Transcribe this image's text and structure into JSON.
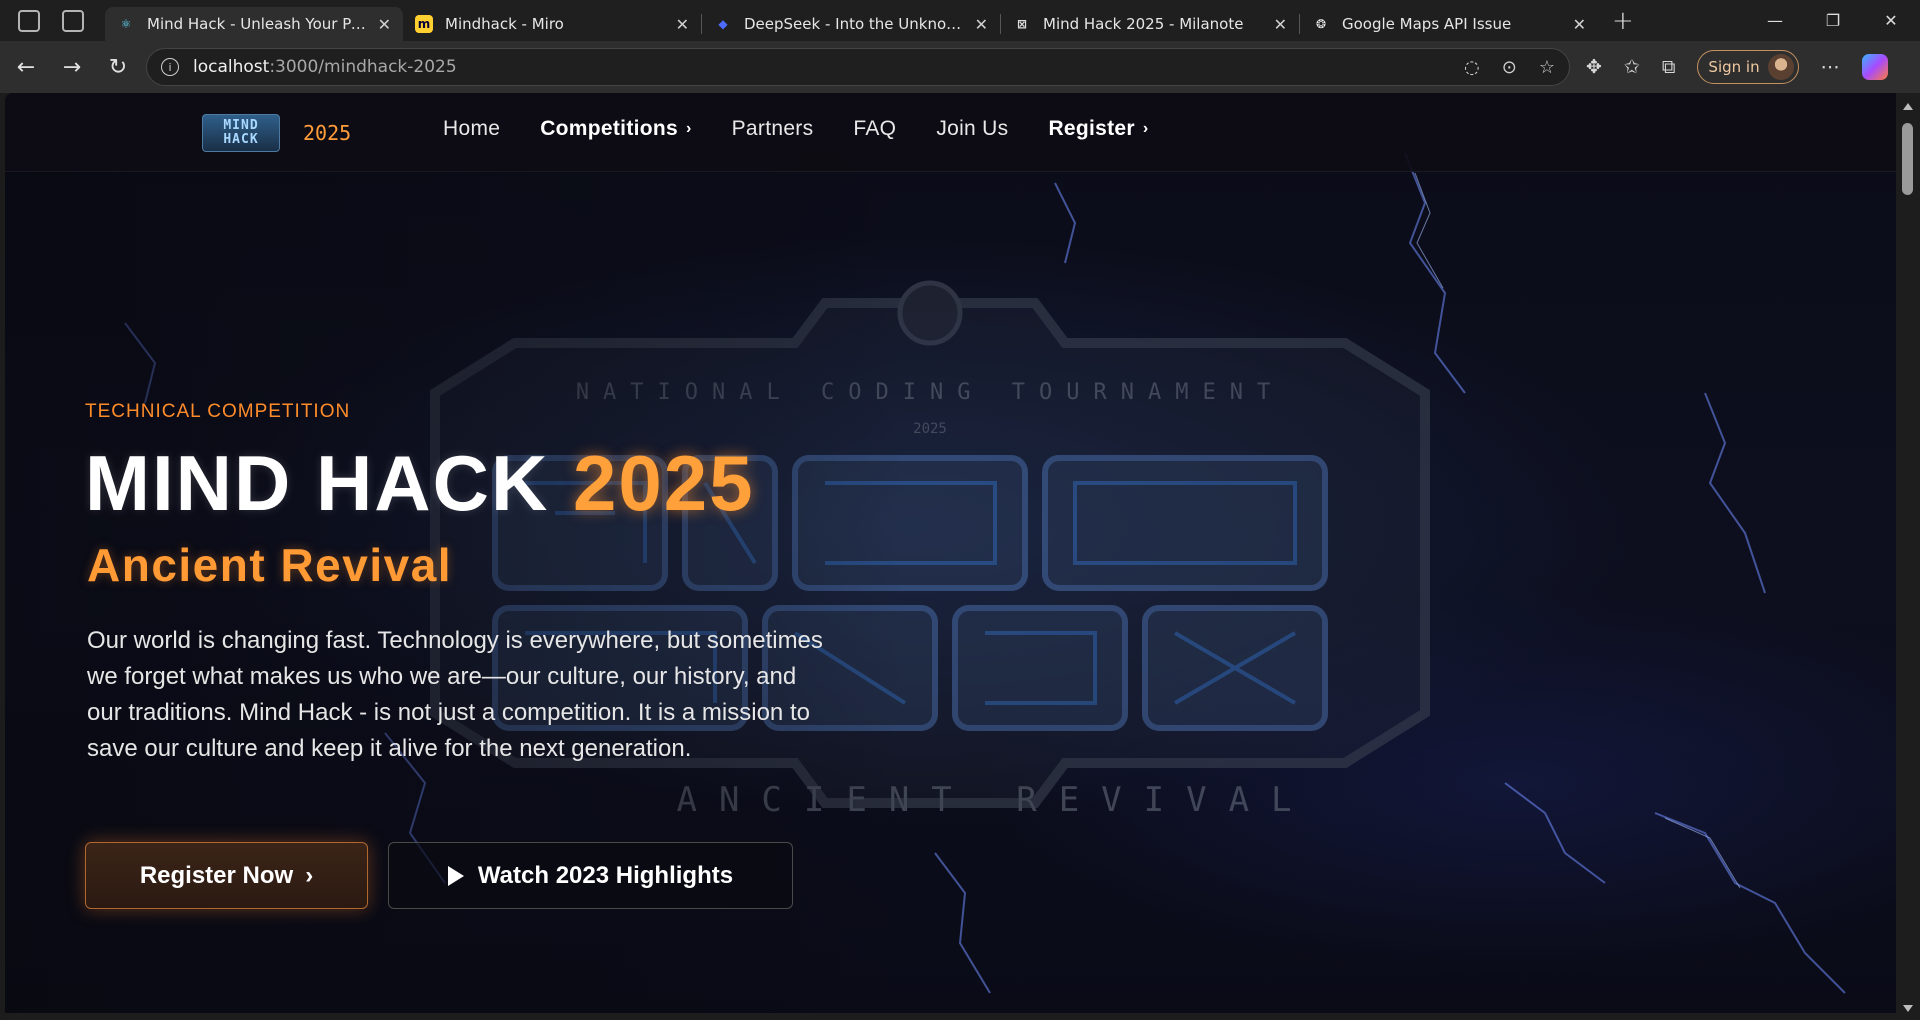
{
  "browser": {
    "tabs": [
      {
        "title": "Mind Hack - Unleash Your Potenti",
        "favicon": "react-icon",
        "active": true
      },
      {
        "title": "Mindhack - Miro",
        "favicon": "miro-icon",
        "active": false
      },
      {
        "title": "DeepSeek - Into the Unknown",
        "favicon": "deepseek-icon",
        "active": false
      },
      {
        "title": "Mind Hack 2025 - Milanote",
        "favicon": "milanote-icon",
        "active": false
      },
      {
        "title": "Google Maps API Issue",
        "favicon": "openai-icon",
        "active": false
      }
    ],
    "url_host": "localhost",
    "url_path": ":3000/mindhack-2025",
    "signin_label": "Sign in"
  },
  "site": {
    "logo_text_1": "MIND",
    "logo_text_2": "HACK",
    "logo_year": "2025",
    "nav": [
      {
        "label": "Home"
      },
      {
        "label": "Competitions"
      },
      {
        "label": "Partners"
      },
      {
        "label": "FAQ"
      },
      {
        "label": "Join Us"
      },
      {
        "label": "Register"
      }
    ]
  },
  "hero": {
    "tag": "TECHNICAL COMPETITION",
    "title_main": "MIND HACK ",
    "title_year": "2025",
    "subtitle": "Ancient Revival",
    "description": "Our world is changing fast. Technology is everywhere, but sometimes we forget what makes us who we are—our culture, our history, and our traditions. Mind Hack - is not just a competition. It is a mission to save our culture and keep it alive for the next generation.",
    "primary_cta": "Register Now",
    "secondary_cta": "Watch 2023 Highlights",
    "emblem_top_text": "NATIONAL CODING TOURNAMENT",
    "emblem_bottom_text": "ANCIENT REVIVAL",
    "emblem_year": "2025"
  },
  "colors": {
    "accent_orange": "#ff9a35",
    "background": "#0a0a13"
  }
}
